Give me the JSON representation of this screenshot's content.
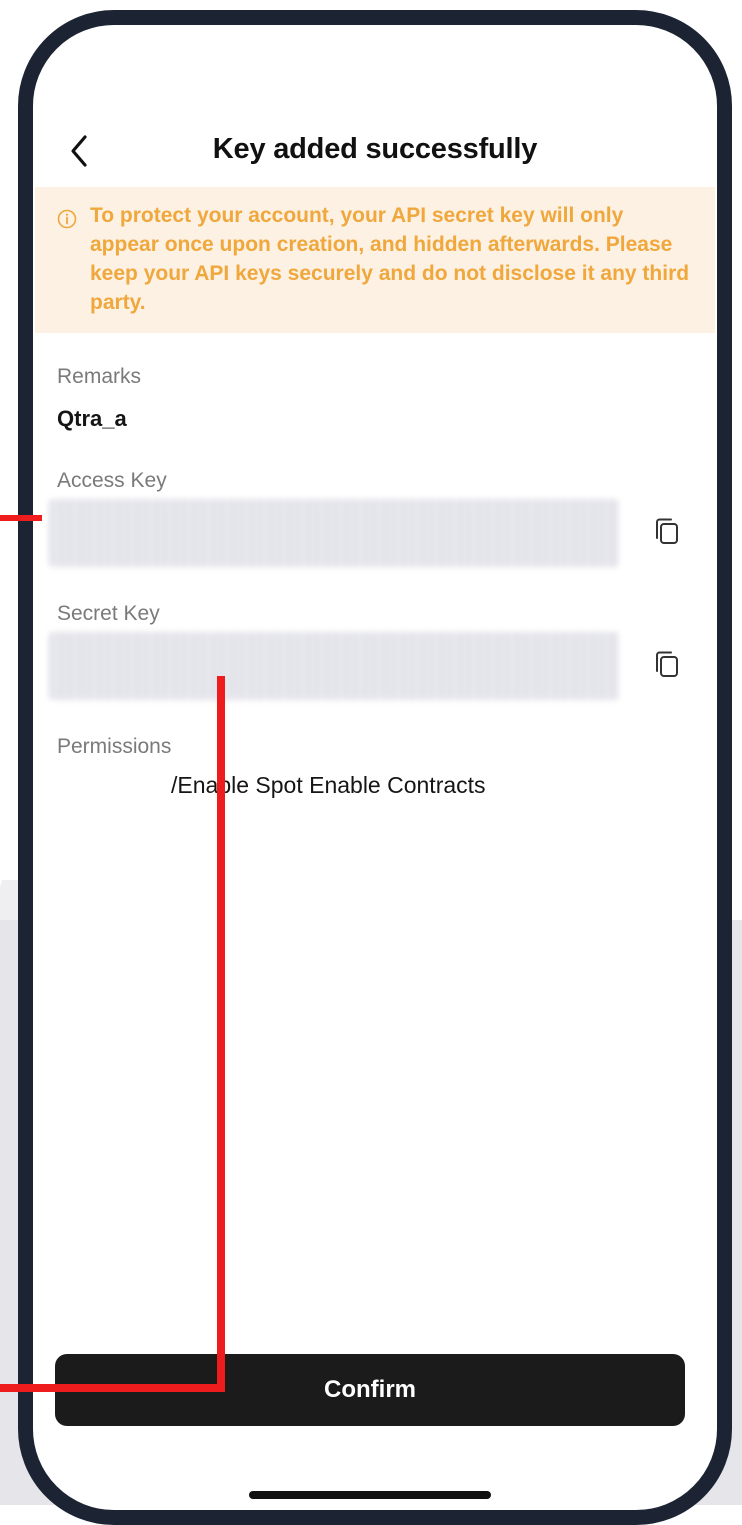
{
  "header": {
    "title": "Key added successfully",
    "back_icon": "chevron-left-icon"
  },
  "notice": {
    "icon": "info-circle-icon",
    "text": "To protect your account, your API secret key will only appear once upon creation, and hidden afterwards. Please keep your API keys securely and do not disclose it any third party.",
    "color": "#f0a73c",
    "background": "#fcf1e3"
  },
  "fields": {
    "remarks": {
      "label": "Remarks",
      "value": "Qtra_a"
    },
    "access_key": {
      "label": "Access Key",
      "copy_icon": "copy-icon"
    },
    "secret_key": {
      "label": "Secret Key",
      "copy_icon": "copy-icon"
    },
    "permissions": {
      "label": "Permissions",
      "value": "/Enable Spot Enable Contracts"
    }
  },
  "confirm": {
    "label": "Confirm"
  },
  "colors": {
    "frame": "#1c2433",
    "button": "#1b1b1b",
    "annotation": "#ee1c1c"
  }
}
